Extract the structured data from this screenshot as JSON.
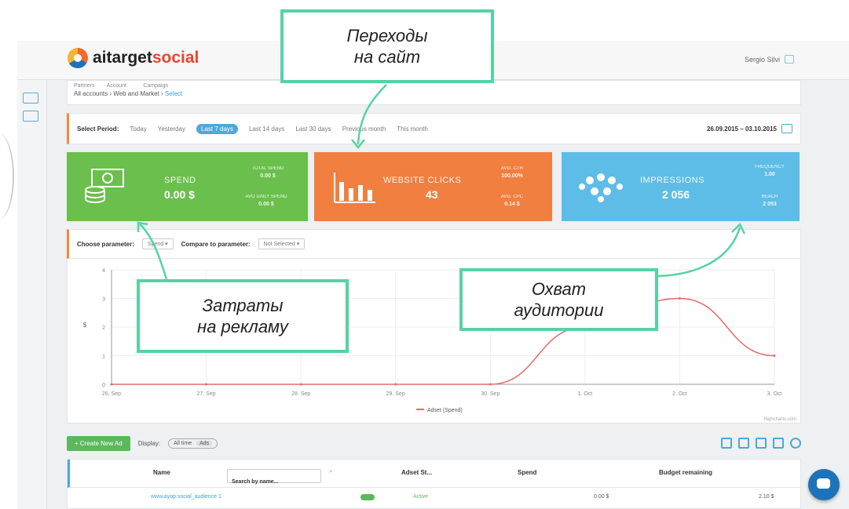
{
  "app": {
    "logo_part1": "aitarget",
    "logo_part2": "social",
    "user": "Sergio Silvi"
  },
  "breadcrumb": {
    "l1": "Partners",
    "l2": "Account",
    "l3": "Campaign",
    "v1": "All accounts",
    "v2": "Web and Market",
    "v3": "Select"
  },
  "period": {
    "label": "Select Period:",
    "options": [
      "Today",
      "Yesterday",
      "Last 7 days",
      "Last 14 days",
      "Last 30 days",
      "Previous month",
      "This month"
    ],
    "range": "26.09.2015 – 03.10.2015"
  },
  "cards": {
    "spend": {
      "label": "SPEND",
      "value": "0.00 $",
      "mini1_label": "TOTAL SPEND",
      "mini1_val": "0.00 $",
      "mini2_label": "AVG DAILY SPEND",
      "mini2_val": "0.00 $"
    },
    "clicks": {
      "label": "WEBSITE CLICKS",
      "value": "43",
      "mini1_label": "AVG. CTR",
      "mini1_val": "100.00%",
      "mini2_label": "AVG. CPC",
      "mini2_val": "0.14 $"
    },
    "impressions": {
      "label": "IMPRESSIONS",
      "value": "2 056",
      "mini1_label": "FREQUENCY",
      "mini1_val": "1.00",
      "mini2_label": "REACH",
      "mini2_val": "2 053"
    }
  },
  "parameter": {
    "choose_label": "Choose parameter:",
    "choose_value": "Spend",
    "compare_label": "Compare to parameter:",
    "compare_value": "Not Selected"
  },
  "chart_data": {
    "type": "line",
    "x": [
      "26. Sep",
      "27. Sep",
      "28. Sep",
      "29. Sep",
      "30. Sep",
      "1. Oct",
      "2. Oct",
      "3. Oct"
    ],
    "series": [
      {
        "name": "Adset (Spend)",
        "values": [
          0,
          0,
          0,
          0,
          0,
          2,
          3,
          1
        ]
      }
    ],
    "ylim": [
      0,
      4
    ],
    "yticks": [
      "0",
      "1",
      "2",
      "3",
      "4"
    ],
    "ylabel": "$",
    "legend_position": "bottom",
    "credit": "Highcharts.com",
    "color": "#e36b6b"
  },
  "toolbar": {
    "create_label": "+ Create New Ad",
    "display_label": "Display:",
    "toggle_a": "All time",
    "toggle_b": "Ads"
  },
  "table": {
    "col_name": "Name",
    "search_placeholder": "Search by name...",
    "col_status": "Adset St...",
    "col_spend": "Spend",
    "col_budget": "Budget remaining",
    "row": {
      "name": "www.ayop.social_audience 1",
      "status": "Active",
      "spend": "0.00 $",
      "budget": "2.10 $"
    }
  },
  "callouts": {
    "clicks": [
      "Переходы",
      "на сайт"
    ],
    "spend": [
      "Затраты",
      "на рекламу"
    ],
    "reach": [
      "Охват",
      "аудитории"
    ]
  }
}
